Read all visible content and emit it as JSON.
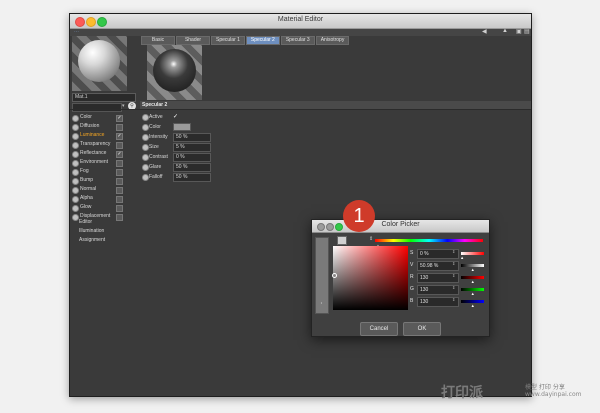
{
  "window": {
    "title": "Material Editor"
  },
  "material": {
    "name": "Mat.1"
  },
  "channels": [
    {
      "label": "Color",
      "checked": "✓",
      "active": false
    },
    {
      "label": "Diffusion",
      "checked": "",
      "active": false
    },
    {
      "label": "Luminance",
      "checked": "✓",
      "active": true
    },
    {
      "label": "Transparency",
      "checked": "",
      "active": false
    },
    {
      "label": "Reflectance",
      "checked": "✓",
      "active": false
    },
    {
      "label": "Environment",
      "checked": "",
      "active": false
    },
    {
      "label": "Fog",
      "checked": "",
      "active": false
    },
    {
      "label": "Bump",
      "checked": "",
      "active": false
    },
    {
      "label": "Normal",
      "checked": "",
      "active": false
    },
    {
      "label": "Alpha",
      "checked": "",
      "active": false
    },
    {
      "label": "Glow",
      "checked": "",
      "active": false
    },
    {
      "label": "Displacement",
      "checked": "",
      "active": false
    }
  ],
  "sub_items": [
    "Editor",
    "Illumination",
    "Assignment"
  ],
  "tabs": [
    {
      "label": "Basic",
      "active": false
    },
    {
      "label": "Shader",
      "active": false
    },
    {
      "label": "Specular 1",
      "active": false
    },
    {
      "label": "Specular 2",
      "active": true
    },
    {
      "label": "Specular 3",
      "active": false
    },
    {
      "label": "Anisotropy",
      "active": false
    }
  ],
  "section": {
    "title": "Specular 2"
  },
  "properties": {
    "active": {
      "label": "Active",
      "value": "✓"
    },
    "color": {
      "label": "Color",
      "swatch": "#9a9a9a"
    },
    "intensity": {
      "label": "Intensity",
      "value": "50 %"
    },
    "size": {
      "label": "Size",
      "value": "5 %"
    },
    "contrast": {
      "label": "Contrast",
      "value": "0 %"
    },
    "glare": {
      "label": "Glare",
      "value": "50 %"
    },
    "falloff": {
      "label": "Falloff",
      "value": "50 %"
    }
  },
  "color_picker": {
    "title": "Color Picker",
    "step_number": "1",
    "fields": [
      {
        "label": "S",
        "value": "0 %",
        "fill": 0.05,
        "gradient": "linear-gradient(to right,#ffffff,#ff0000)"
      },
      {
        "label": "V",
        "value": "50.98 %",
        "fill": 0.51,
        "gradient": "linear-gradient(to right,#000000,#ffffff)"
      },
      {
        "label": "R",
        "value": "130",
        "fill": 0.51,
        "gradient": "linear-gradient(to right,#000000,#ff0000)"
      },
      {
        "label": "G",
        "value": "130",
        "fill": 0.51,
        "gradient": "linear-gradient(to right,#000000,#00ff00)"
      },
      {
        "label": "B",
        "value": "130",
        "fill": 0.51,
        "gradient": "linear-gradient(to right,#000000,#0000ff)"
      }
    ],
    "cancel_label": "Cancel",
    "ok_label": "OK"
  },
  "watermark": {
    "main": "打印派",
    "sub": "模型 打印 分享",
    "url": "www.dayinpai.com"
  }
}
